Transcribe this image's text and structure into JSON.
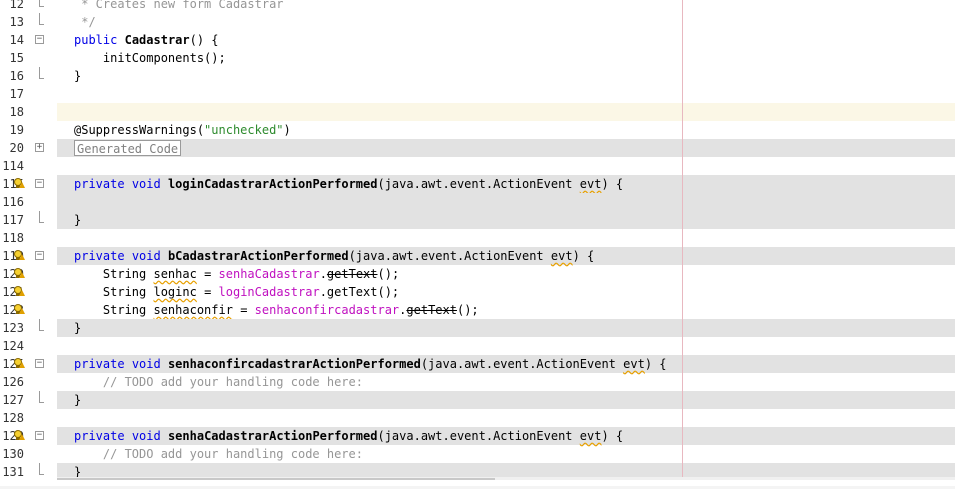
{
  "colors": {
    "keyword": "#0000e6",
    "string": "#2e8b2e",
    "field": "#c010c0",
    "comment": "#969696",
    "guarded_bg": "#e2e2e2",
    "current_line_bg": "#fbf7e6",
    "margin_line": "#e8b8c0"
  },
  "editor": {
    "lines": [
      {
        "num": "12",
        "fold": "tail",
        "icon": null,
        "style": "",
        "kind": "comment",
        "parts": [
          {
            "t": " * Creates new form Cadastrar",
            "c": "cmt"
          }
        ]
      },
      {
        "num": "13",
        "fold": "tail",
        "icon": null,
        "style": "",
        "kind": "comment",
        "parts": [
          {
            "t": " */",
            "c": "cmt"
          }
        ]
      },
      {
        "num": "14",
        "fold": "minus",
        "icon": null,
        "style": "",
        "kind": "code",
        "parts": [
          {
            "t": "public",
            "c": "kw"
          },
          {
            "t": " "
          },
          {
            "t": "Cadastrar",
            "c": "fn"
          },
          {
            "t": "() {"
          }
        ]
      },
      {
        "num": "15",
        "fold": null,
        "icon": null,
        "style": "",
        "kind": "code",
        "parts": [
          {
            "t": "    initComponents();"
          }
        ]
      },
      {
        "num": "16",
        "fold": "tail",
        "icon": null,
        "style": "",
        "kind": "code",
        "parts": [
          {
            "t": "}"
          }
        ]
      },
      {
        "num": "17",
        "fold": null,
        "icon": null,
        "style": "",
        "kind": "code",
        "parts": []
      },
      {
        "num": "18",
        "fold": null,
        "icon": null,
        "style": "current",
        "kind": "code",
        "parts": []
      },
      {
        "num": "19",
        "fold": null,
        "icon": null,
        "style": "",
        "kind": "code",
        "parts": [
          {
            "t": "@SuppressWarnings("
          },
          {
            "t": "\"unchecked\"",
            "c": "str"
          },
          {
            "t": ")"
          }
        ]
      },
      {
        "num": "20",
        "fold": "plus",
        "icon": null,
        "style": "guarded",
        "kind": "generated",
        "label": "Generated Code"
      },
      {
        "num": "114",
        "fold": null,
        "icon": null,
        "style": "",
        "kind": "code",
        "parts": []
      },
      {
        "num": "115",
        "fold": "minus",
        "icon": "bulb",
        "style": "guarded",
        "kind": "code",
        "parts": [
          {
            "t": "private",
            "c": "kw"
          },
          {
            "t": " "
          },
          {
            "t": "void",
            "c": "kw"
          },
          {
            "t": " "
          },
          {
            "t": "loginCadastrarActionPerformed",
            "c": "fn"
          },
          {
            "t": "(java.awt.event.ActionEvent "
          },
          {
            "t": "evt",
            "c": "wavy"
          },
          {
            "t": ") {"
          }
        ]
      },
      {
        "num": "116",
        "fold": null,
        "icon": null,
        "style": "guarded",
        "kind": "code",
        "parts": []
      },
      {
        "num": "117",
        "fold": "tail",
        "icon": null,
        "style": "guarded",
        "kind": "code",
        "parts": [
          {
            "t": "}"
          }
        ]
      },
      {
        "num": "118",
        "fold": null,
        "icon": null,
        "style": "",
        "kind": "code",
        "parts": []
      },
      {
        "num": "119",
        "fold": "minus",
        "icon": "bulb",
        "style": "guarded",
        "kind": "code",
        "parts": [
          {
            "t": "private",
            "c": "kw"
          },
          {
            "t": " "
          },
          {
            "t": "void",
            "c": "kw"
          },
          {
            "t": " "
          },
          {
            "t": "bCadastrarActionPerformed",
            "c": "fn"
          },
          {
            "t": "(java.awt.event.ActionEvent "
          },
          {
            "t": "evt",
            "c": "wavy"
          },
          {
            "t": ") {"
          }
        ]
      },
      {
        "num": "120",
        "fold": null,
        "icon": "bulb",
        "style": "",
        "kind": "code",
        "parts": [
          {
            "t": "    String "
          },
          {
            "t": "senhac",
            "c": "wavy"
          },
          {
            "t": " = "
          },
          {
            "t": "senhaCadastrar",
            "c": "fld"
          },
          {
            "t": "."
          },
          {
            "t": "getText",
            "c": "strike"
          },
          {
            "t": "();"
          }
        ]
      },
      {
        "num": "121",
        "fold": null,
        "icon": "bulb",
        "style": "",
        "kind": "code",
        "parts": [
          {
            "t": "    String "
          },
          {
            "t": "loginc",
            "c": "wavy"
          },
          {
            "t": " = "
          },
          {
            "t": "loginCadastrar",
            "c": "fld"
          },
          {
            "t": ".getText();"
          }
        ]
      },
      {
        "num": "122",
        "fold": null,
        "icon": "bulb",
        "style": "",
        "kind": "code",
        "parts": [
          {
            "t": "    String "
          },
          {
            "t": "senhaconfir",
            "c": "wavy"
          },
          {
            "t": " = "
          },
          {
            "t": "senhaconfircadastrar",
            "c": "fld"
          },
          {
            "t": "."
          },
          {
            "t": "getText",
            "c": "strike"
          },
          {
            "t": "();"
          }
        ]
      },
      {
        "num": "123",
        "fold": "tail",
        "icon": null,
        "style": "guarded",
        "kind": "code",
        "parts": [
          {
            "t": "}"
          }
        ]
      },
      {
        "num": "124",
        "fold": null,
        "icon": null,
        "style": "",
        "kind": "code",
        "parts": []
      },
      {
        "num": "125",
        "fold": "minus",
        "icon": "bulb",
        "style": "guarded",
        "kind": "code",
        "parts": [
          {
            "t": "private",
            "c": "kw"
          },
          {
            "t": " "
          },
          {
            "t": "void",
            "c": "kw"
          },
          {
            "t": " "
          },
          {
            "t": "senhaconfircadastrarActionPerformed",
            "c": "fn"
          },
          {
            "t": "(java.awt.event.ActionEvent "
          },
          {
            "t": "evt",
            "c": "wavy"
          },
          {
            "t": ") {"
          }
        ]
      },
      {
        "num": "126",
        "fold": null,
        "icon": null,
        "style": "",
        "kind": "code",
        "parts": [
          {
            "t": "    // TODO add your handling code here:",
            "c": "cmt"
          }
        ]
      },
      {
        "num": "127",
        "fold": "tail",
        "icon": null,
        "style": "guarded",
        "kind": "code",
        "parts": [
          {
            "t": "}"
          }
        ]
      },
      {
        "num": "128",
        "fold": null,
        "icon": null,
        "style": "",
        "kind": "code",
        "parts": []
      },
      {
        "num": "129",
        "fold": "minus",
        "icon": "bulb",
        "style": "guarded",
        "kind": "code",
        "parts": [
          {
            "t": "private",
            "c": "kw"
          },
          {
            "t": " "
          },
          {
            "t": "void",
            "c": "kw"
          },
          {
            "t": " "
          },
          {
            "t": "senhaCadastrarActionPerformed",
            "c": "fn"
          },
          {
            "t": "(java.awt.event.ActionEvent "
          },
          {
            "t": "evt",
            "c": "wavy"
          },
          {
            "t": ") {"
          }
        ]
      },
      {
        "num": "130",
        "fold": null,
        "icon": null,
        "style": "",
        "kind": "code",
        "parts": [
          {
            "t": "    // TODO add your handling code here:",
            "c": "cmt"
          }
        ]
      },
      {
        "num": "131",
        "fold": "tail",
        "icon": null,
        "style": "guarded",
        "kind": "code",
        "parts": [
          {
            "t": "}"
          }
        ]
      }
    ]
  }
}
